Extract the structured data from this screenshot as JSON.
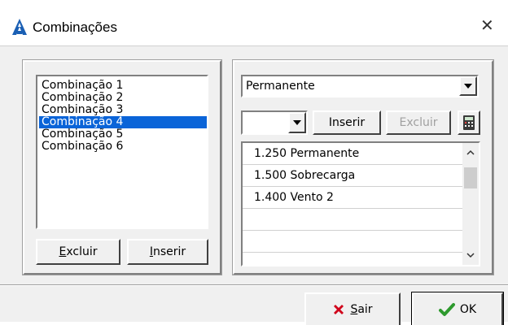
{
  "window": {
    "title": "Combinações",
    "close_glyph": "✕"
  },
  "left_list": {
    "items": [
      "Combinação 1",
      "Combinação 2",
      "Combinação 3",
      "Combinação 4",
      "Combinação 5",
      "Combinação 6"
    ],
    "selected_index": 3
  },
  "left_buttons": {
    "excluir": {
      "mnemonic": "E",
      "rest": "xcluir"
    },
    "inserir": {
      "mnemonic": "I",
      "rest": "nserir"
    }
  },
  "right": {
    "case_select": "Permanente",
    "factor_select": "",
    "inserir_label": "Inserir",
    "excluir_label": "Excluir",
    "grid_rows": [
      "1.250 Permanente",
      "1.500 Sobrecarga",
      "1.400 Vento 2",
      "",
      ""
    ]
  },
  "footer": {
    "sair": {
      "mnemonic": "S",
      "rest": "air"
    },
    "ok_label": "OK"
  },
  "colors": {
    "selection": "#0a64d8",
    "app_icon": "#1a5fb4",
    "ok_check": "#2e9a2e",
    "sair_x": "#d0021b"
  }
}
